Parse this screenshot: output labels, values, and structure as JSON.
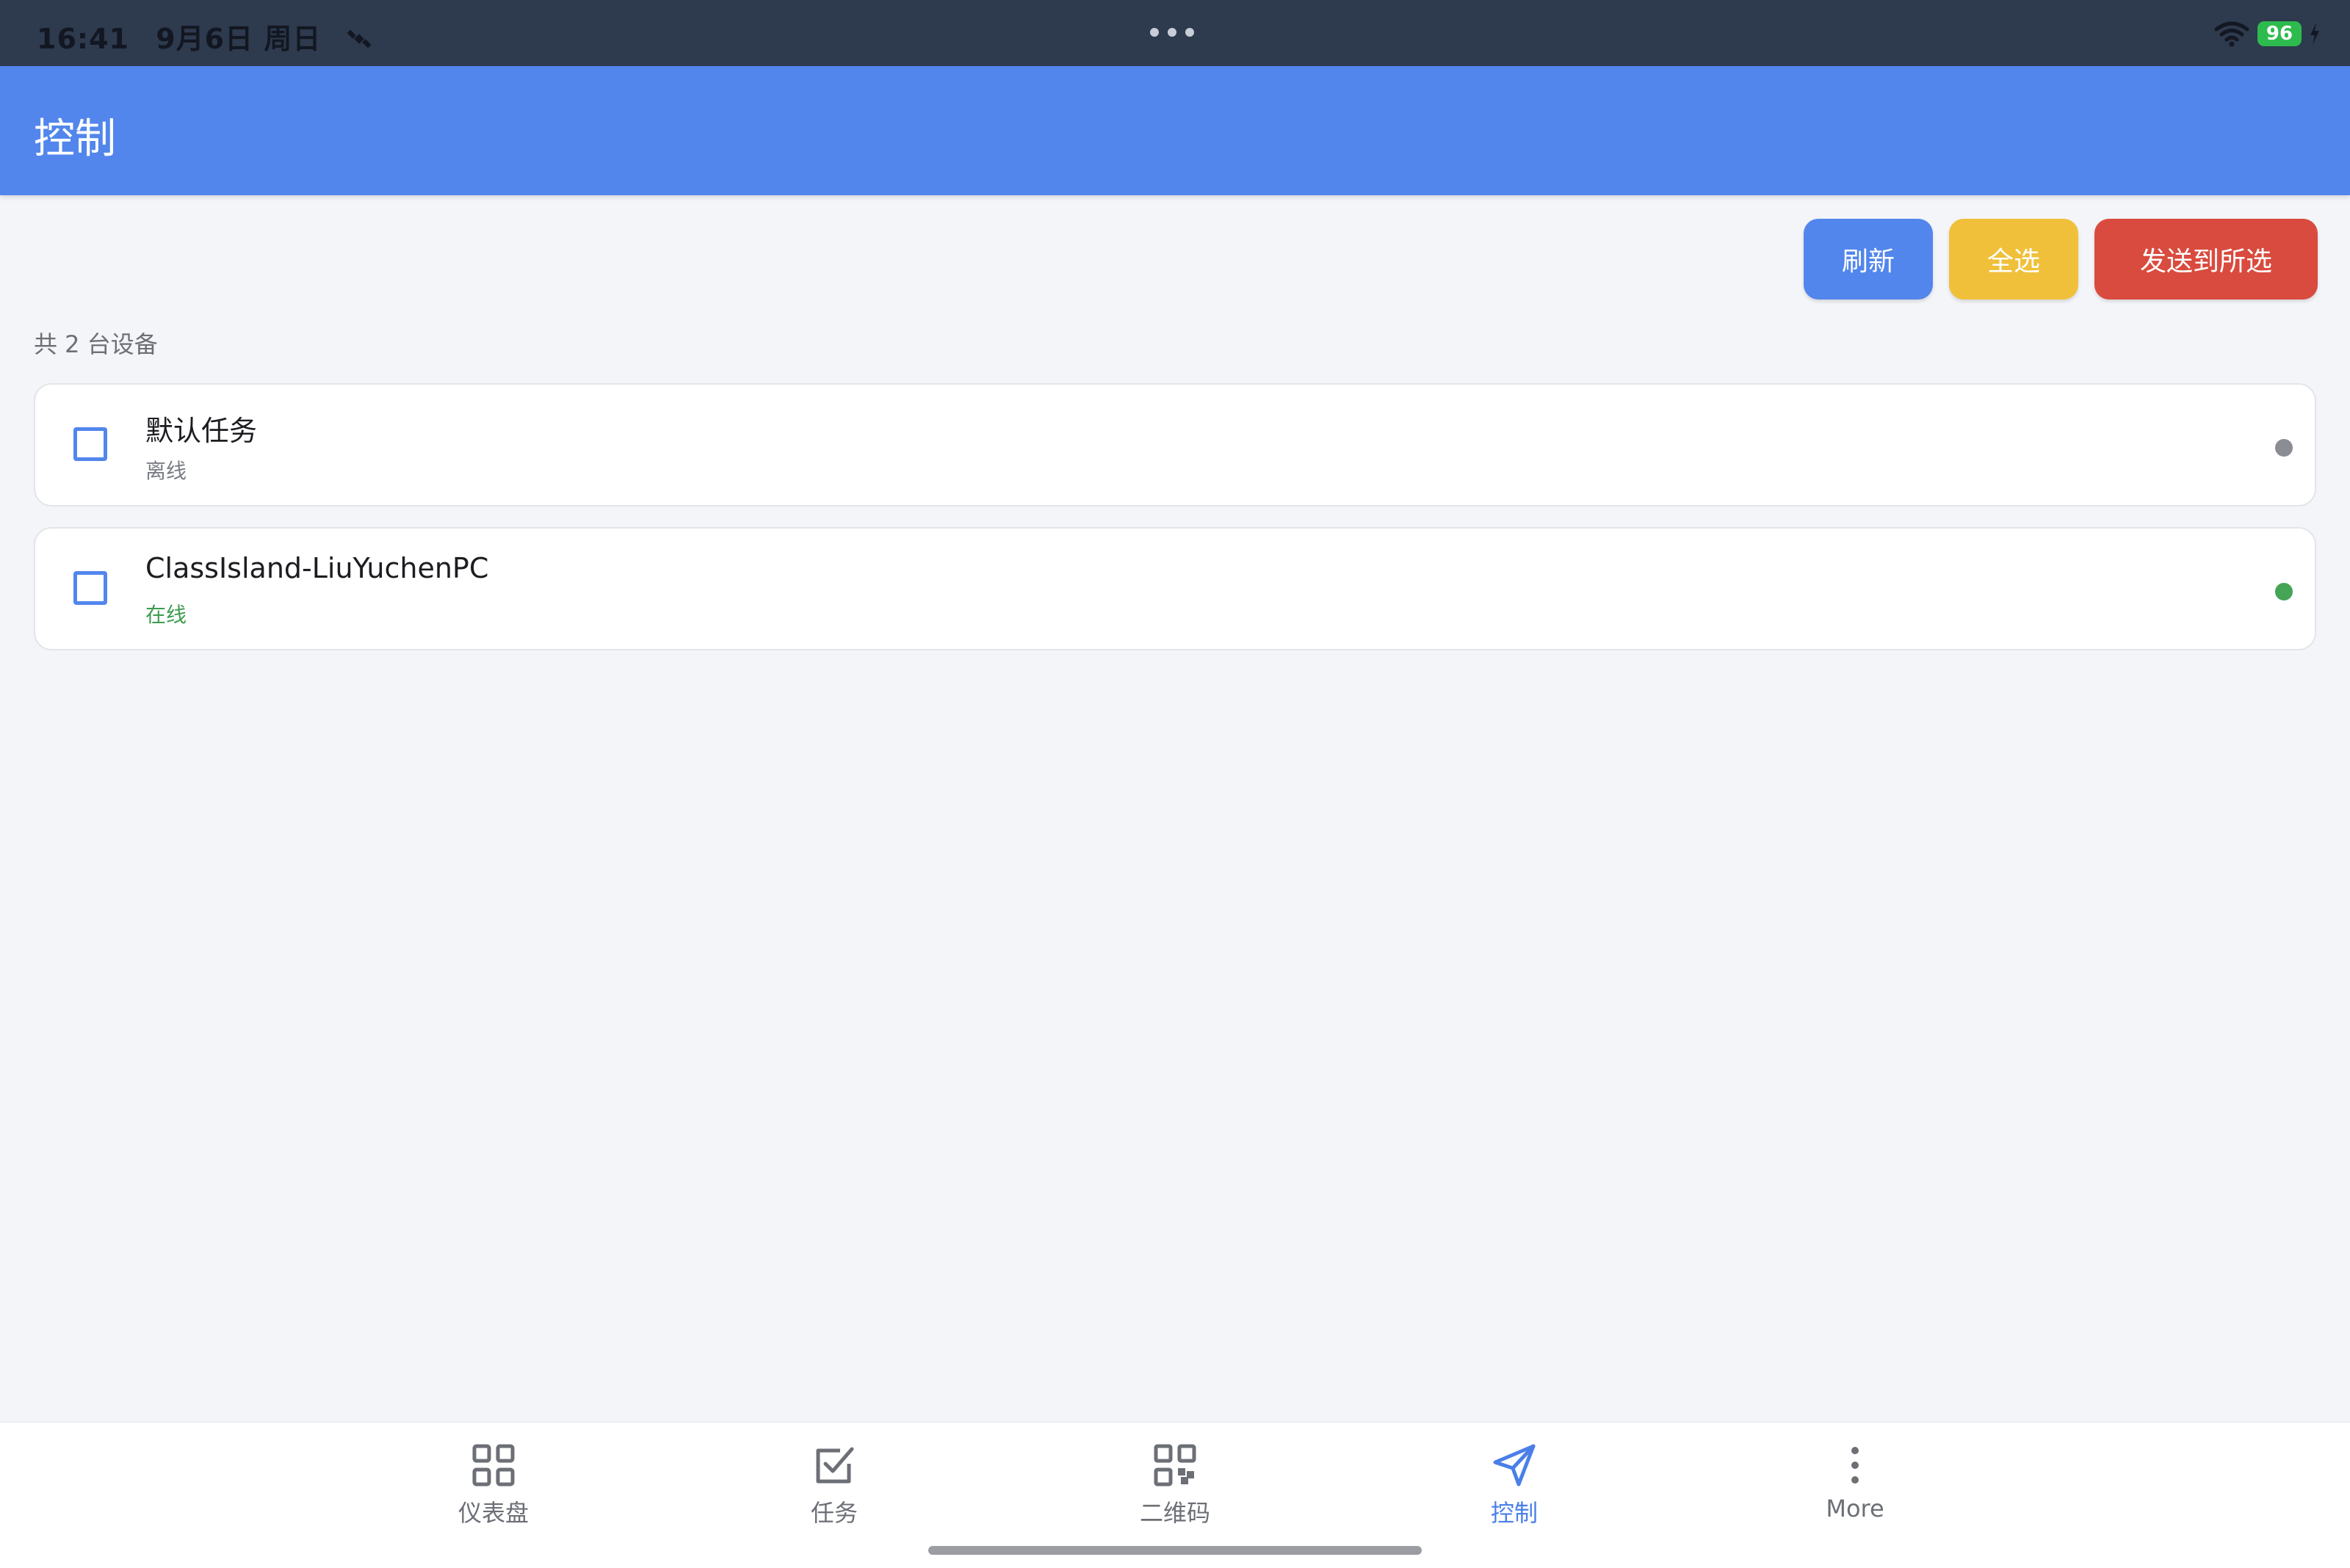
{
  "status_bar": {
    "time": "16:41",
    "date": "9月6日 周日",
    "battery": "96",
    "colors": {
      "battery": "#2dbb4e",
      "background": "#2e3a4e"
    },
    "icons": [
      "satellite-icon",
      "more-dots-icon",
      "wifi-icon",
      "battery-icon",
      "charging-bolt-icon"
    ]
  },
  "app_bar": {
    "title": "控制",
    "color": "#5286ec"
  },
  "actions": {
    "refresh": "刷新",
    "select_all": "全选",
    "send_selected": "发送到所选",
    "colors": {
      "refresh": "#5286ec",
      "select_all": "#f0c03b",
      "send_selected": "#d94b3e"
    }
  },
  "device_count": "共 2 台设备",
  "devices": [
    {
      "name": "默认任务",
      "status": "离线",
      "online": false,
      "checked": false,
      "status_color": "#8a8d93"
    },
    {
      "name": "ClassIsland-LiuYuchenPC",
      "status": "在线",
      "online": true,
      "checked": false,
      "status_color": "#45a456"
    }
  ],
  "bottom_nav": {
    "active": "控制",
    "active_color": "#4a7fe8",
    "items": [
      {
        "label": "仪表盘",
        "icon": "dashboard-grid-icon"
      },
      {
        "label": "任务",
        "icon": "checkbox-icon"
      },
      {
        "label": "二维码",
        "icon": "qr-code-icon"
      },
      {
        "label": "控制",
        "icon": "send-icon"
      },
      {
        "label": "More",
        "icon": "more-vertical-icon"
      }
    ]
  }
}
